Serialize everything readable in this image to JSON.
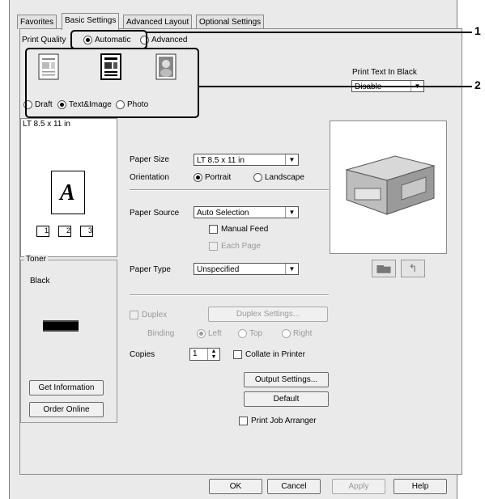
{
  "tabs": [
    "Favorites",
    "Basic Settings",
    "Advanced Layout",
    "Optional Settings"
  ],
  "print_quality": {
    "label": "Print Quality",
    "automatic": "Automatic",
    "advanced": "Advanced",
    "modes": [
      "Draft",
      "Text&Image",
      "Photo"
    ],
    "selected_mode": "Text&Image"
  },
  "print_text_black": {
    "label": "Print Text In Black",
    "value": "Disable"
  },
  "preview": {
    "paper_label": "LT 8.5 x 11 in",
    "glyph": "A",
    "page_icons": [
      "1",
      "2",
      "3"
    ]
  },
  "toner": {
    "group_label": "Toner",
    "color": "Black",
    "get_info": "Get Information",
    "order_online": "Order Online"
  },
  "paper": {
    "size_label": "Paper Size",
    "size_value": "LT 8.5 x 11 in",
    "orientation_label": "Orientation",
    "portrait": "Portrait",
    "landscape": "Landscape",
    "source_label": "Paper Source",
    "source_value": "Auto Selection",
    "manual_feed": "Manual Feed",
    "each_page": "Each Page",
    "type_label": "Paper Type",
    "type_value": "Unspecified"
  },
  "duplex": {
    "label": "Duplex",
    "settings_button": "Duplex Settings...",
    "binding_label": "Binding",
    "left": "Left",
    "top": "Top",
    "right": "Right"
  },
  "copies": {
    "label": "Copies",
    "value": "1",
    "collate": "Collate in Printer"
  },
  "buttons": {
    "output_settings": "Output Settings...",
    "default": "Default",
    "job_arranger": "Print Job Arranger"
  },
  "footer": {
    "ok": "OK",
    "cancel": "Cancel",
    "apply": "Apply",
    "help": "Help"
  },
  "callouts": [
    "1",
    "2"
  ]
}
